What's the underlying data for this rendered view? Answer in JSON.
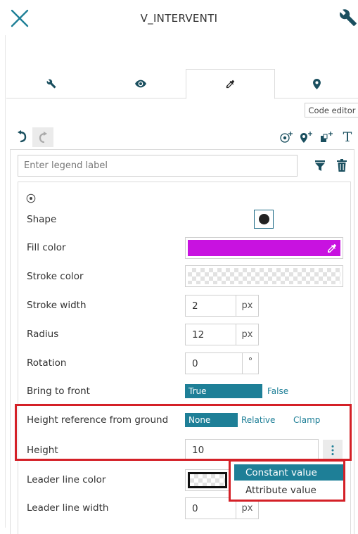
{
  "header": {
    "title": "V_INTERVENTI",
    "close_icon": "close-icon",
    "settings_icon": "wrench-icon"
  },
  "tabs": [
    {
      "icon": "wrench-icon",
      "active": false
    },
    {
      "icon": "eye-icon",
      "active": false
    },
    {
      "icon": "eyedropper-icon",
      "active": true
    },
    {
      "icon": "map-pin-icon",
      "active": false
    }
  ],
  "code_editor_label": "Code editor",
  "toolbar": {
    "undo_icon": "undo-icon",
    "redo_icon": "redo-icon",
    "add_point_icon": "add-point-icon",
    "add_pin_icon": "add-pin-icon",
    "add_model_icon": "add-model-icon",
    "text_icon_glyph": "T"
  },
  "legend": {
    "placeholder": "Enter legend label",
    "value": ""
  },
  "style": {
    "shape_label": "Shape",
    "fill_color_label": "Fill color",
    "fill_color": "#c812e0",
    "stroke_color_label": "Stroke color",
    "stroke_color": "transparent",
    "stroke_width_label": "Stroke width",
    "stroke_width": "2",
    "stroke_width_unit": "px",
    "radius_label": "Radius",
    "radius": "12",
    "radius_unit": "px",
    "rotation_label": "Rotation",
    "rotation": "0",
    "rotation_unit": "°",
    "bring_to_front_label": "Bring to front",
    "bring_to_front_options": [
      "True",
      "False"
    ],
    "bring_to_front_selected": "True",
    "height_reference_label": "Height reference from ground",
    "height_reference_options": [
      "None",
      "Relative",
      "Clamp"
    ],
    "height_reference_selected": "None",
    "height_label": "Height",
    "height": "10",
    "leader_line_color_label": "Leader line color",
    "leader_line_width_label": "Leader line width",
    "leader_line_width": "0",
    "leader_line_width_unit": "px"
  },
  "value_type_menu": {
    "items": [
      "Constant value",
      "Attribute value"
    ],
    "selected": "Constant value"
  },
  "colors": {
    "accent": "#1e7f97",
    "highlight": "#d42027",
    "fill": "#c812e0"
  }
}
